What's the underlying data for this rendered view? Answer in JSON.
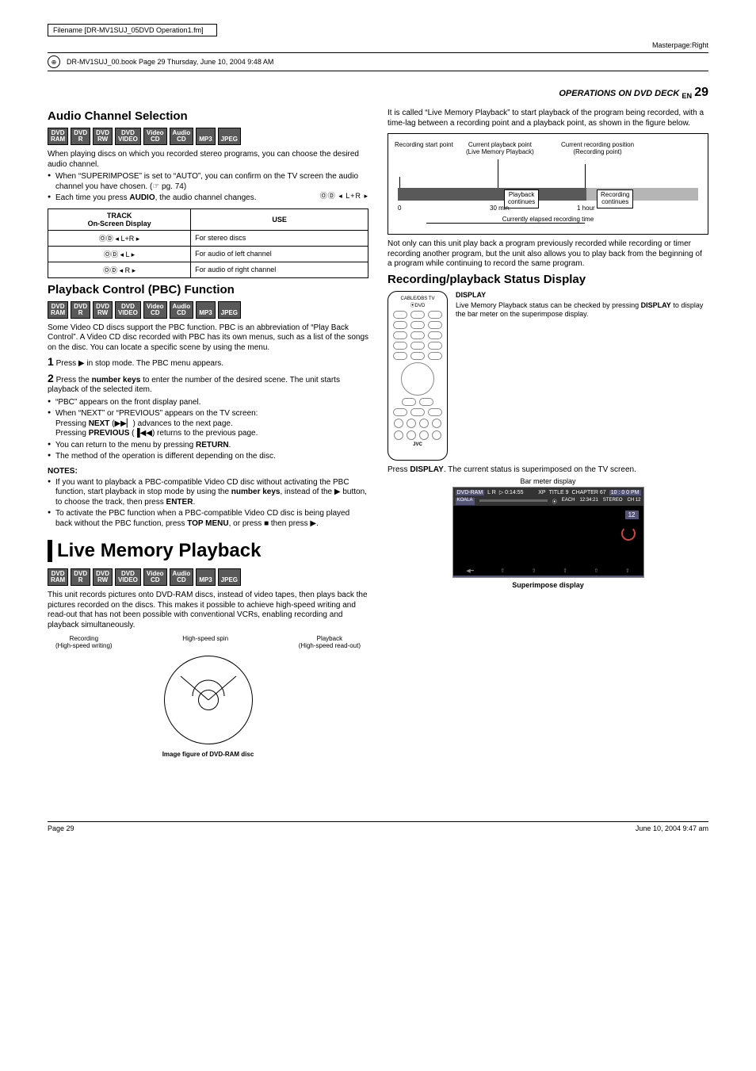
{
  "header": {
    "filename": "Filename [DR-MV1SUJ_05DVD Operation1.fm]",
    "masterpage": "Masterpage:Right",
    "bookline": "DR-MV1SUJ_00.book  Page 29  Thursday, June 10, 2004  9:48 AM",
    "section": "OPERATIONS ON DVD DECK",
    "lang": "EN",
    "pagenum": "29"
  },
  "badges": [
    "DVD RAM",
    "DVD R",
    "DVD RW",
    "DVD VIDEO",
    "Video CD",
    "Audio CD",
    "MP3",
    "JPEG"
  ],
  "audio": {
    "title": "Audio Channel Selection",
    "intro": "When playing discs on which you recorded stereo programs, you can choose the desired audio channel.",
    "b1": "When “SUPERIMPOSE” is set to “AUTO”, you can confirm on the TV screen the audio channel you have chosen. (☞ pg. 74)",
    "b2_a": "Each time you press ",
    "b2_b": "AUDIO",
    "b2_c": ", the audio channel changes.",
    "ind": "ⓄⒹ ◂ L+R ▸",
    "th1": "TRACK",
    "th1b": "On-Screen Display",
    "th2": "USE",
    "r1a": "ⓄⒹ ◂ L+R ▸",
    "r1b": "For stereo discs",
    "r2a": "ⓄⒹ ◂ L ▸",
    "r2b": "For audio of left channel",
    "r3a": "ⓄⒹ ◂ R ▸",
    "r3b": "For audio of right channel"
  },
  "pbc": {
    "title": "Playback Control (PBC) Function",
    "intro": "Some Video CD discs support the PBC function. PBC is an abbreviation of “Play Back Control”. A Video CD disc recorded with PBC has its own menus, such as a list of the songs on the disc. You can locate a specific scene by using the menu.",
    "s1": "Press ▶ in stop mode. The PBC menu appears.",
    "s2a": "Press the ",
    "s2b": "number keys",
    "s2c": " to enter the number of the desired scene. The unit starts playback of the selected item.",
    "b1": "“PBC” appears on the front display panel.",
    "b2": "When “NEXT” or “PREVIOUS” appears on the TV screen:",
    "b2a_a": "Pressing ",
    "b2a_b": "NEXT",
    "b2a_c": " (▶▶▏) advances to the next page.",
    "b2b_a": "Pressing ",
    "b2b_b": "PREVIOUS",
    "b2b_c": " (▐◀◀) returns to the previous page.",
    "b3_a": "You can return to the menu by pressing ",
    "b3_b": "RETURN",
    "b3_c": ".",
    "b4": "The method of the operation is different depending on the disc.",
    "notes": "NOTES:",
    "n1_a": "If you want to playback a PBC-compatible Video CD disc without activating the PBC function, start playback in stop mode by using the ",
    "n1_b": "number keys",
    "n1_c": ", instead of the ▶ button, to choose the track, then press ",
    "n1_d": "ENTER",
    "n1_e": ".",
    "n2_a": "To activate the PBC function when a PBC-compatible Video CD disc is being played back without the PBC function, press ",
    "n2_b": "TOP MENU",
    "n2_c": ", or press ■ then press ▶."
  },
  "live": {
    "title": "Live Memory Playback",
    "intro": "This unit records pictures onto DVD-RAM discs, instead of video tapes, then plays back the pictures recorded on the discs. This makes it possible to achieve high-speed writing and read-out that has not been possible with conventional VCRs, enabling recording and playback simultaneously.",
    "dl1": "Recording",
    "dl1b": "(High-speed writing)",
    "dl2": "High-speed spin",
    "dl3": "Playback",
    "dl3b": "(High-speed read-out)",
    "dcap": "Image figure of DVD-RAM disc"
  },
  "right": {
    "intro": "It is called “Live Memory Playback” to start playback of the program being recorded, with a time-lag between a recording point and a playback point, as shown in the figure below.",
    "tl": {
      "cpp1": "Current playback point",
      "cpp2": "(Live Memory Playback)",
      "crp1": "Current recording position",
      "crp2": "(Recording point)",
      "rsp": "Recording start point",
      "pb1": "Playback",
      "pb2": "continues",
      "rc1": "Recording",
      "rc2": "continues",
      "t0": "0",
      "t30": "30 min.",
      "t1h": "1 hour",
      "elapsed": "Currently elapsed recording time"
    },
    "after": "Not only can this unit play back a program previously recorded while recording or timer recording another program, but the unit also allows you to play back from the beginning of a program while continuing to record the same program.",
    "status_title": "Recording/playback Status Display",
    "disp_h": "DISPLAY",
    "disp_t_a": "Live Memory Playback status can be checked by pressing ",
    "disp_t_b": "DISPLAY",
    "disp_t_c": " to display the bar meter on the superimpose display.",
    "press_a": "Press ",
    "press_b": "DISPLAY",
    "press_c": ". The current status is superimposed on the TV screen.",
    "bar_label": "Bar meter display",
    "super": "Superimpose display",
    "bm": {
      "dvd": "DVD-RAM",
      "lr": "L R",
      "time": "0:14:55",
      "xp": "XP",
      "title": "TITLE 9",
      "chap": "CHAPTER 67",
      "clock": "10 : 0 0 PM",
      "koala": "KOALA",
      "t2": "12:34:21",
      "stereo": "STEREO",
      "ch": "CH 12",
      "badge12": "12"
    },
    "remote": {
      "brand": "JVC",
      "top": "CABLE/DBS  TV  ⦿DVD"
    }
  },
  "footer": {
    "left": "Page 29",
    "right": "June 10, 2004  9:47 am"
  }
}
